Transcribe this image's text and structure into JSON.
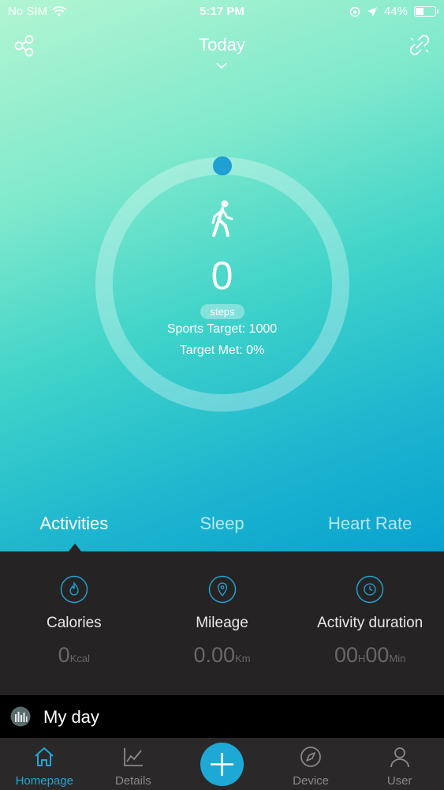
{
  "status": {
    "carrier": "No SIM",
    "time": "5:17 PM",
    "battery": "44%",
    "battery_level": 0.44
  },
  "header": {
    "title": "Today"
  },
  "ring": {
    "steps": "0",
    "steps_unit": "steps",
    "sports_target": "Sports Target: 1000",
    "target_met": "Target Met: 0%",
    "progress": 0
  },
  "tabs": [
    {
      "label": "Activities",
      "active": true
    },
    {
      "label": "Sleep",
      "active": false
    },
    {
      "label": "Heart Rate",
      "active": false
    }
  ],
  "metrics": [
    {
      "label": "Calories",
      "value": "0",
      "unit": "Kcal",
      "icon": "flame-icon"
    },
    {
      "label": "Mileage",
      "value": "0.00",
      "unit": "Km",
      "icon": "location-pin-icon"
    },
    {
      "label": "Activity duration",
      "value_h": "00",
      "unit_h": "H",
      "value_m": "00",
      "unit_m": "Min",
      "icon": "clock-icon"
    }
  ],
  "myday": {
    "label": "My day"
  },
  "nav": [
    {
      "label": "Homepage",
      "icon": "home-icon",
      "active": true
    },
    {
      "label": "Details",
      "icon": "chart-icon",
      "active": false
    },
    {
      "label": "",
      "icon": "plus-icon",
      "active": false
    },
    {
      "label": "Device",
      "icon": "compass-icon",
      "active": false
    },
    {
      "label": "User",
      "icon": "user-icon",
      "active": false
    }
  ],
  "colors": {
    "accent": "#1ea8d6",
    "panel": "#262324",
    "nav": "#2a2829"
  }
}
